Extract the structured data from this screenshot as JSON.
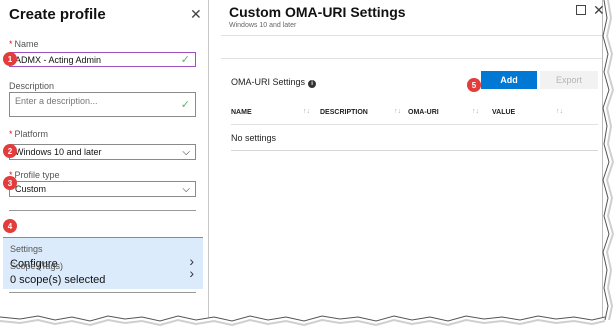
{
  "left_blade": {
    "title": "Create profile",
    "name_label": "Name",
    "name_value": "ADMX  -  Acting Admin",
    "description_label": "Description",
    "description_placeholder": "Enter a description...",
    "platform_label": "Platform",
    "platform_value": "Windows 10 and later",
    "profile_type_label": "Profile type",
    "profile_type_value": "Custom",
    "settings_label": "Settings",
    "settings_value": "Configure",
    "scope_label": "Scope (Tags)",
    "scope_value": "0 scope(s) selected",
    "required_marker": "*"
  },
  "right_blade": {
    "title": "Custom OMA-URI Settings",
    "subtitle": "Windows 10 and later",
    "section_label": "OMA-URI Settings",
    "add_label": "Add",
    "export_label": "Export",
    "columns": [
      "NAME",
      "DESCRIPTION",
      "OMA-URI",
      "VALUE"
    ],
    "empty_text": "No settings"
  },
  "badges": [
    "1",
    "2",
    "3",
    "4",
    "5"
  ],
  "colors": {
    "accent_blue": "#0078d4",
    "selected_row": "#dcebfb",
    "badge_red": "#e23c3c",
    "check_green": "#5cb85c",
    "active_border": "#a24fbf"
  }
}
